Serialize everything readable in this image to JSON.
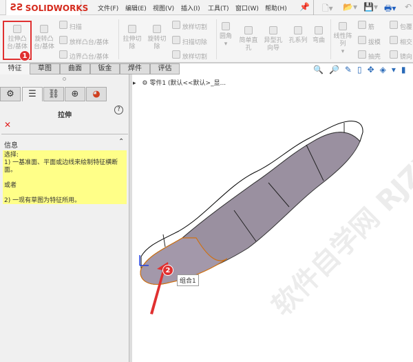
{
  "app": {
    "logo": "SOLIDWORKS"
  },
  "menu": [
    "文件(F)",
    "编辑(E)",
    "视图(V)",
    "插入(I)",
    "工具(T)",
    "窗口(W)",
    "帮助(H)"
  ],
  "toolbar": {
    "extrude_boss": "拉伸凸台/基体",
    "revolve_boss": "旋转凸台/基体",
    "sweep": "扫描",
    "loft_boss": "放样凸台/基体",
    "boundary_boss": "边界凸台/基体",
    "extrude_cut": "拉伸切除",
    "revolve_cut": "旋转切除",
    "loft_cut": "放样切割",
    "sweep_cut": "扫描切除",
    "loft_cut2": "放样切割",
    "fillet": "圆角",
    "simple_hole": "简单直孔",
    "hole_wizard": "异型孔向导",
    "hole_series": "孔系列",
    "flex": "弯曲",
    "linear_pattern": "线性阵列",
    "rib": "筋",
    "draft": "拔模",
    "shell": "抽壳",
    "wrap": "包覆",
    "intersect": "相交",
    "mirror": "镜向"
  },
  "tabs": [
    "特征",
    "草图",
    "曲面",
    "钣金",
    "焊件",
    "评估"
  ],
  "panel": {
    "title": "拉伸",
    "section": "信息",
    "info_lines": [
      "选择:",
      "1) 一基准面、平面或边线来绘制特征横断面。",
      "",
      "或者",
      "",
      "2) 一现有草图为特征所用。"
    ]
  },
  "tree": {
    "root": "零件1  (默认<<默认>_显..."
  },
  "tooltip": "组合1",
  "annotations": {
    "marker1": "1",
    "marker2": "2"
  },
  "colors": {
    "accent_red": "#e03030",
    "info_bg": "#ffff88",
    "face_gray": "#9a90a0"
  },
  "watermark": "软件自学网 RJZXW.COM"
}
